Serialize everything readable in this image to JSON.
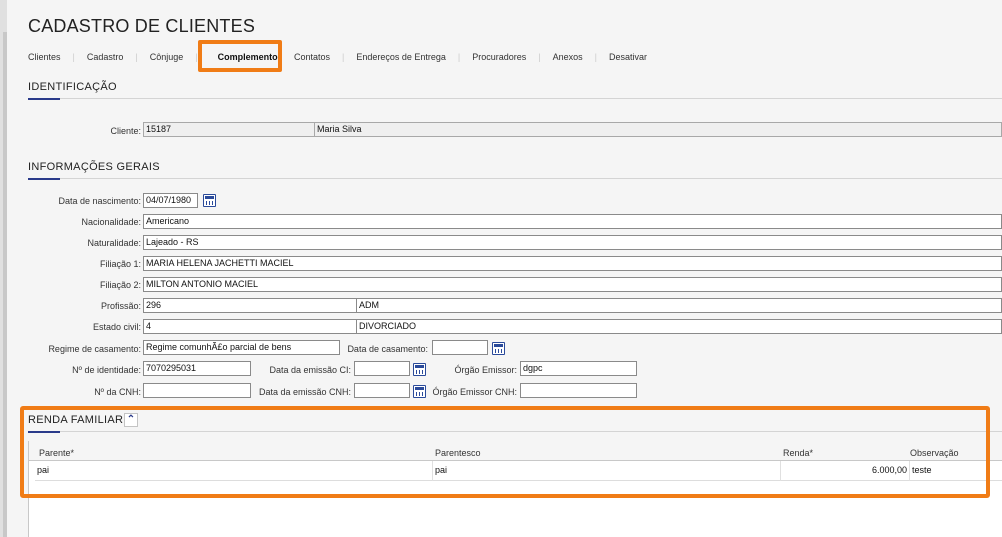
{
  "page": {
    "title": "CADASTRO DE CLIENTES"
  },
  "tabs": [
    "Clientes",
    "Cadastro",
    "Cônjuge",
    "Complemento",
    "Contatos",
    "Endereços de Entrega",
    "Procuradores",
    "Anexos",
    "Desativar"
  ],
  "active_tab": "Complemento",
  "identificacao": {
    "title": "IDENTIFICAÇÃO",
    "cliente_label": "Cliente:",
    "cliente_codigo": "15187",
    "cliente_nome": "Maria Silva"
  },
  "info": {
    "title": "INFORMAÇÕES GERAIS",
    "data_nascimento_label": "Data de nascimento:",
    "data_nascimento": "04/07/1980",
    "nacionalidade_label": "Nacionalidade:",
    "nacionalidade": "Americano",
    "naturalidade_label": "Naturalidade:",
    "naturalidade": "Lajeado - RS",
    "filiacao1_label": "Filiação 1:",
    "filiacao1": "MARIA HELENA JACHETTI MACIEL",
    "filiacao2_label": "Filiação 2:",
    "filiacao2": "MILTON ANTONIO MACIEL",
    "profissao_label": "Profissão:",
    "profissao_codigo": "296",
    "profissao_nome": "ADM",
    "estado_civil_label": "Estado civil:",
    "estado_civil_codigo": "4",
    "estado_civil_nome": "DIVORCIADO",
    "regime_label": "Regime de casamento:",
    "regime": "Regime comunhÃ£o parcial de bens",
    "data_casamento_label": "Data de casamento:",
    "data_casamento": "",
    "identidade_label": "Nº de identidade:",
    "identidade": "7070295031",
    "emissao_ci_label": "Data da emissão CI:",
    "emissao_ci": "",
    "orgao_emissor_label": "Órgão Emissor:",
    "orgao_emissor": "dgpc",
    "cnh_label": "Nº da CNH:",
    "cnh": "",
    "emissao_cnh_label": "Data da emissão CNH:",
    "emissao_cnh": "",
    "orgao_cnh_label": "Órgão Emissor CNH:",
    "orgao_cnh": ""
  },
  "renda": {
    "title": "RENDA FAMILIAR",
    "collapse_icon": "double-chevron-up-icon",
    "columns": [
      "Parente*",
      "Parentesco",
      "Renda*",
      "Observação"
    ],
    "rows": [
      {
        "parente": "pai",
        "parentesco": "pai",
        "renda": "6.000,00",
        "observacao": "teste"
      }
    ]
  },
  "colors": {
    "highlight": "#f07c16",
    "accent": "#2a3a8a"
  }
}
